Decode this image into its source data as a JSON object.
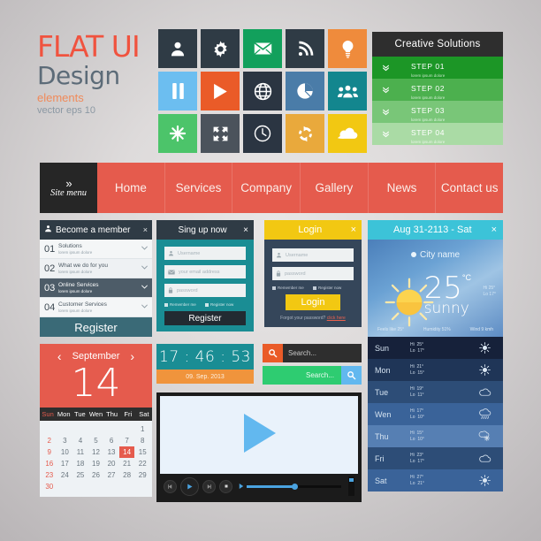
{
  "title_block": {
    "line1": "FLAT UI",
    "line2": "Design",
    "line3": "elements",
    "line4": "vector eps 10",
    "color_accent": "#f0533f",
    "color_dark": "#5c6b78"
  },
  "icon_grid": {
    "icons": [
      {
        "name": "user-icon",
        "bg": "#2f3b45"
      },
      {
        "name": "gear-icon",
        "bg": "#2f3b45"
      },
      {
        "name": "envelope-icon",
        "bg": "#12a05c"
      },
      {
        "name": "rss-icon",
        "bg": "#2f3b45"
      },
      {
        "name": "lightbulb-icon",
        "bg": "#ef8b3c"
      },
      {
        "name": "pause-icon",
        "bg": "#6cbef0"
      },
      {
        "name": "play-icon",
        "bg": "#ea5b28"
      },
      {
        "name": "globe-icon",
        "bg": "#2b3542"
      },
      {
        "name": "pie-chart-icon",
        "bg": "#4a7ca8"
      },
      {
        "name": "people-icon",
        "bg": "#13868e"
      },
      {
        "name": "asterisk-icon",
        "bg": "#4cc46a"
      },
      {
        "name": "expand-icon",
        "bg": "#4b535c"
      },
      {
        "name": "clock-icon",
        "bg": "#2b3542"
      },
      {
        "name": "refresh-icon",
        "bg": "#e9a93c"
      },
      {
        "name": "cloud-icon",
        "bg": "#f2c812"
      }
    ]
  },
  "steps_panel": {
    "header": "Creative Solutions",
    "steps": [
      {
        "title": "STEP 01",
        "sub": "lorem ipsum dolore",
        "bg": "#1c9626"
      },
      {
        "title": "STEP 02",
        "sub": "lorem ipsum dolore",
        "bg": "#4cb04e"
      },
      {
        "title": "STEP 03",
        "sub": "lorem ipsum dolore",
        "bg": "#79c678"
      },
      {
        "title": "STEP 04",
        "sub": "lorem ipsum dolore",
        "bg": "#aadba5"
      }
    ]
  },
  "navbar": {
    "site_menu_label": "Site menu",
    "site_menu_chevrons": "»",
    "items": [
      {
        "label": "Home"
      },
      {
        "label": "Services"
      },
      {
        "label": "Company"
      },
      {
        "label": "Gallery"
      },
      {
        "label": "News"
      },
      {
        "label": "Contact us"
      }
    ],
    "bg": "#e55b4d"
  },
  "accordion": {
    "header": "Become a member",
    "close": "×",
    "items": [
      {
        "num": "01",
        "title": "Solutions",
        "sub": "lorem ipsum dolore"
      },
      {
        "num": "02",
        "title": "What we do for you",
        "sub": "lorem ipsum dolore"
      },
      {
        "num": "03",
        "title": "Online Services",
        "sub": "lorem ipsum dolore"
      },
      {
        "num": "04",
        "title": "Customer Services",
        "sub": "lorem ipsum dolore"
      }
    ],
    "button": "Register"
  },
  "signup": {
    "header": "Sing up now",
    "close": "×",
    "fields": [
      {
        "icon": "user-icon",
        "placeholder": "Username"
      },
      {
        "icon": "envelope-icon",
        "placeholder": "your email address"
      },
      {
        "icon": "lock-icon",
        "placeholder": "password"
      }
    ],
    "checkbox_left": "Remember me",
    "checkbox_right": "Register now",
    "button": "Register"
  },
  "login": {
    "header": "Login",
    "close": "×",
    "fields": [
      {
        "icon": "user-icon",
        "placeholder": "Username"
      },
      {
        "icon": "lock-icon",
        "placeholder": "password"
      }
    ],
    "checkbox_left": "Remember me",
    "checkbox_right": "Register now",
    "button": "Login",
    "footer_text": "Forgot your password?",
    "footer_link": "click here"
  },
  "weather": {
    "header": "Aug 31-2113 - Sat",
    "close": "×",
    "city": "City name",
    "temperature": "25",
    "unit": "°C",
    "condition": "sunny",
    "hi": "Hi 25°",
    "lo": "Lo 17°",
    "stats": [
      {
        "label": "Feels like 25°"
      },
      {
        "label": "Humidity 51%"
      },
      {
        "label": "Wind 9 kmh"
      }
    ],
    "forecast": [
      {
        "day": "Sun",
        "hi": "25",
        "lo": "17",
        "icon": "sun-icon",
        "bg": "#16213a"
      },
      {
        "day": "Mon",
        "hi": "21",
        "lo": "15",
        "icon": "sun-icon",
        "bg": "#1f3557"
      },
      {
        "day": "Tue",
        "hi": "19",
        "lo": "11",
        "icon": "cloud-icon",
        "bg": "#2d4d77"
      },
      {
        "day": "Wen",
        "hi": "17",
        "lo": "10",
        "icon": "rain-icon",
        "bg": "#3a6399"
      },
      {
        "day": "Thu",
        "hi": "15",
        "lo": "10",
        "icon": "snow-icon",
        "bg": "#567fb3"
      },
      {
        "day": "Fri",
        "hi": "23",
        "lo": "17",
        "icon": "cloud-icon",
        "bg": "#2d4d77"
      },
      {
        "day": "Sat",
        "hi": "27",
        "lo": "21",
        "icon": "sun-icon",
        "bg": "#3a6399"
      }
    ]
  },
  "calendar": {
    "prev": "‹",
    "next": "›",
    "month": "September",
    "day_number": "14",
    "weekdays": [
      "Sun",
      "Mon",
      "Tue",
      "Wen",
      "Thu",
      "Fri",
      "Sat"
    ],
    "selected": "14",
    "cells": [
      "",
      "",
      "",
      "",
      "",
      "",
      "1",
      "2",
      "3",
      "4",
      "5",
      "6",
      "7",
      "8",
      "9",
      "10",
      "11",
      "12",
      "13",
      "14",
      "15",
      "16",
      "17",
      "18",
      "19",
      "20",
      "21",
      "22",
      "23",
      "24",
      "25",
      "26",
      "27",
      "28",
      "29",
      "30",
      "",
      "",
      "",
      "",
      "",
      ""
    ]
  },
  "clock": {
    "time": "17 : 46 : 53",
    "date": "09. Sep. 2013"
  },
  "search": {
    "dark_placeholder": "Search...",
    "green_placeholder": "Search...",
    "icon": "search-icon"
  },
  "video": {
    "play_icon": "play-icon",
    "prev_icon": "prev-icon",
    "play_button_icon": "play-icon",
    "next_icon": "next-icon",
    "stop_icon": "stop-icon",
    "progress_percent": 50
  }
}
